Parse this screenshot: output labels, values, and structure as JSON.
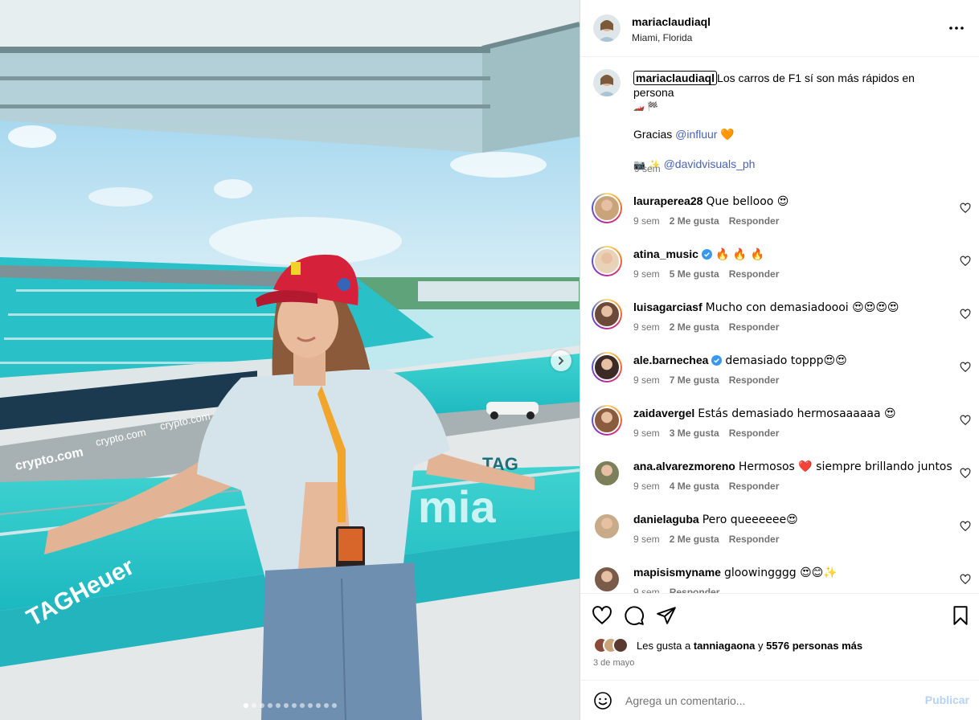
{
  "post": {
    "username": "mariaclaudiaql",
    "location": "Miami, Florida",
    "caption_line1": "Los carros de F1 sí son más rápidos en persona",
    "caption_emoji": "🏎️ 🏁",
    "thanks_text": "Gracias",
    "thanks_mention": "@influur",
    "thanks_emoji": "🧡",
    "credit_emoji": "📷 ✨",
    "credit_mention": "@davidvisuals_ph",
    "caption_time": "9 sem",
    "carousel_count": 12,
    "carousel_active": 1
  },
  "comments": [
    {
      "user": "lauraperea28",
      "text": "Que bellooo 😍",
      "time": "9 sem",
      "likes": "2 Me gusta",
      "reply": "Responder",
      "verified": false,
      "ring": true,
      "avatar": "#c9a37a"
    },
    {
      "user": "atina_music",
      "text": "🔥 🔥 🔥",
      "time": "9 sem",
      "likes": "5 Me gusta",
      "reply": "Responder",
      "verified": true,
      "ring": true,
      "avatar": "#e8d3b9"
    },
    {
      "user": "luisagarciasf",
      "text": "Mucho con demasiadoooi 😍😍😍😍",
      "time": "9 sem",
      "likes": "2 Me gusta",
      "reply": "Responder",
      "verified": false,
      "ring": true,
      "avatar": "#6b4a3a"
    },
    {
      "user": "ale.barnechea",
      "text": "demasiado toppp😍😍",
      "time": "9 sem",
      "likes": "7 Me gusta",
      "reply": "Responder",
      "verified": true,
      "ring": true,
      "avatar": "#3b2a26"
    },
    {
      "user": "zaidavergel",
      "text": "Estás demasiado hermosaaaaaa 😍",
      "time": "9 sem",
      "likes": "3 Me gusta",
      "reply": "Responder",
      "verified": false,
      "ring": true,
      "avatar": "#8a5b3c"
    },
    {
      "user": "ana.alvarezmoreno",
      "text": "Hermosos ❤️ siempre brillando juntos",
      "time": "9 sem",
      "likes": "4 Me gusta",
      "reply": "Responder",
      "verified": false,
      "ring": false,
      "avatar": "#7d7f5a"
    },
    {
      "user": "danielaguba",
      "text": "Pero queeeeee😍",
      "time": "9 sem",
      "likes": "2 Me gusta",
      "reply": "Responder",
      "verified": false,
      "ring": false,
      "avatar": "#c8ab88"
    },
    {
      "user": "mapisismyname",
      "text": "gloowingggg 😍😊✨",
      "time": "9 sem",
      "likes": "",
      "reply": "Responder",
      "verified": false,
      "ring": false,
      "avatar": "#7a5a48"
    }
  ],
  "likes": {
    "prefix": "Les gusta a",
    "user": "tanniagaona",
    "connector": "y",
    "others": "5576 personas más"
  },
  "date": "3 de mayo",
  "add_comment": {
    "placeholder": "Agrega un comentario...",
    "post_label": "Publicar"
  },
  "colors": {
    "mention": "#4662c4",
    "publish_disabled": "#b6d2f5",
    "secondary_text": "#737373",
    "border": "#dbdbdb"
  },
  "icons": {
    "more": "more-options-icon",
    "like": "heart-icon",
    "comment": "comment-icon",
    "share": "share-icon",
    "save": "bookmark-icon",
    "emoji": "emoji-icon",
    "next": "chevron-right-icon"
  }
}
